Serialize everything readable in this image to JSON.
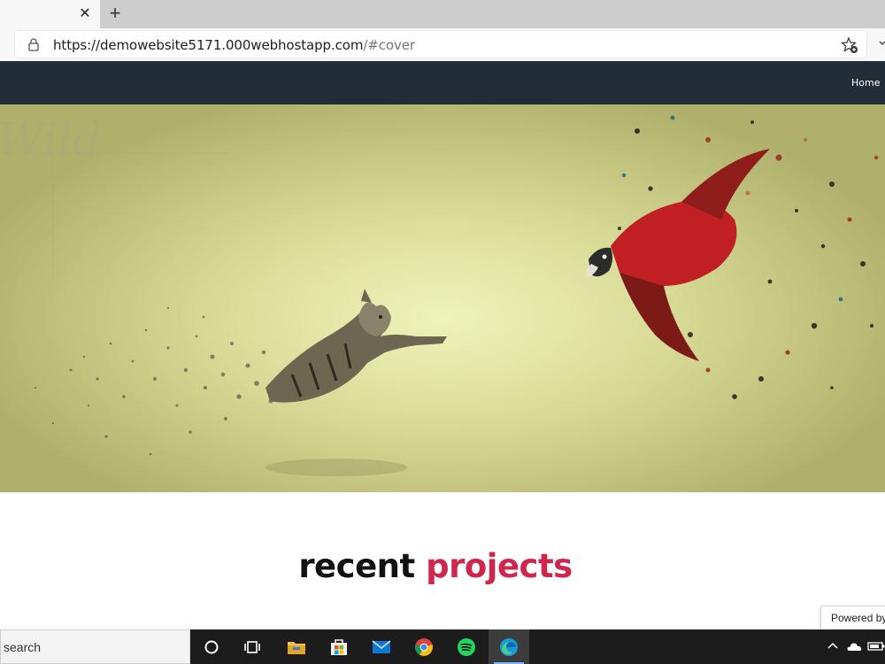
{
  "browser": {
    "tab_close_glyph": "✕",
    "new_tab_glyph": "+",
    "url_host": "https://demowebsite5171.000webhostapp.com",
    "url_path": "/#cover"
  },
  "site": {
    "nav": {
      "home_label": "Home"
    },
    "hero": {
      "background_text": "Wild"
    },
    "section": {
      "title_word1": "recent",
      "title_word2": "projects"
    },
    "powered_by": "Powered by"
  },
  "taskbar": {
    "search_text": "search",
    "apps": [
      "cortana-icon",
      "task-view-icon",
      "file-explorer-icon",
      "microsoft-store-icon",
      "mail-icon",
      "chrome-icon",
      "spotify-icon",
      "edge-icon"
    ],
    "tray": [
      "chevron-up-icon",
      "onedrive-icon",
      "battery-icon"
    ]
  },
  "colors": {
    "nav_bg": "#232d38",
    "title_accent": "#d0264d",
    "taskbar_bg": "#1c1c1c"
  }
}
